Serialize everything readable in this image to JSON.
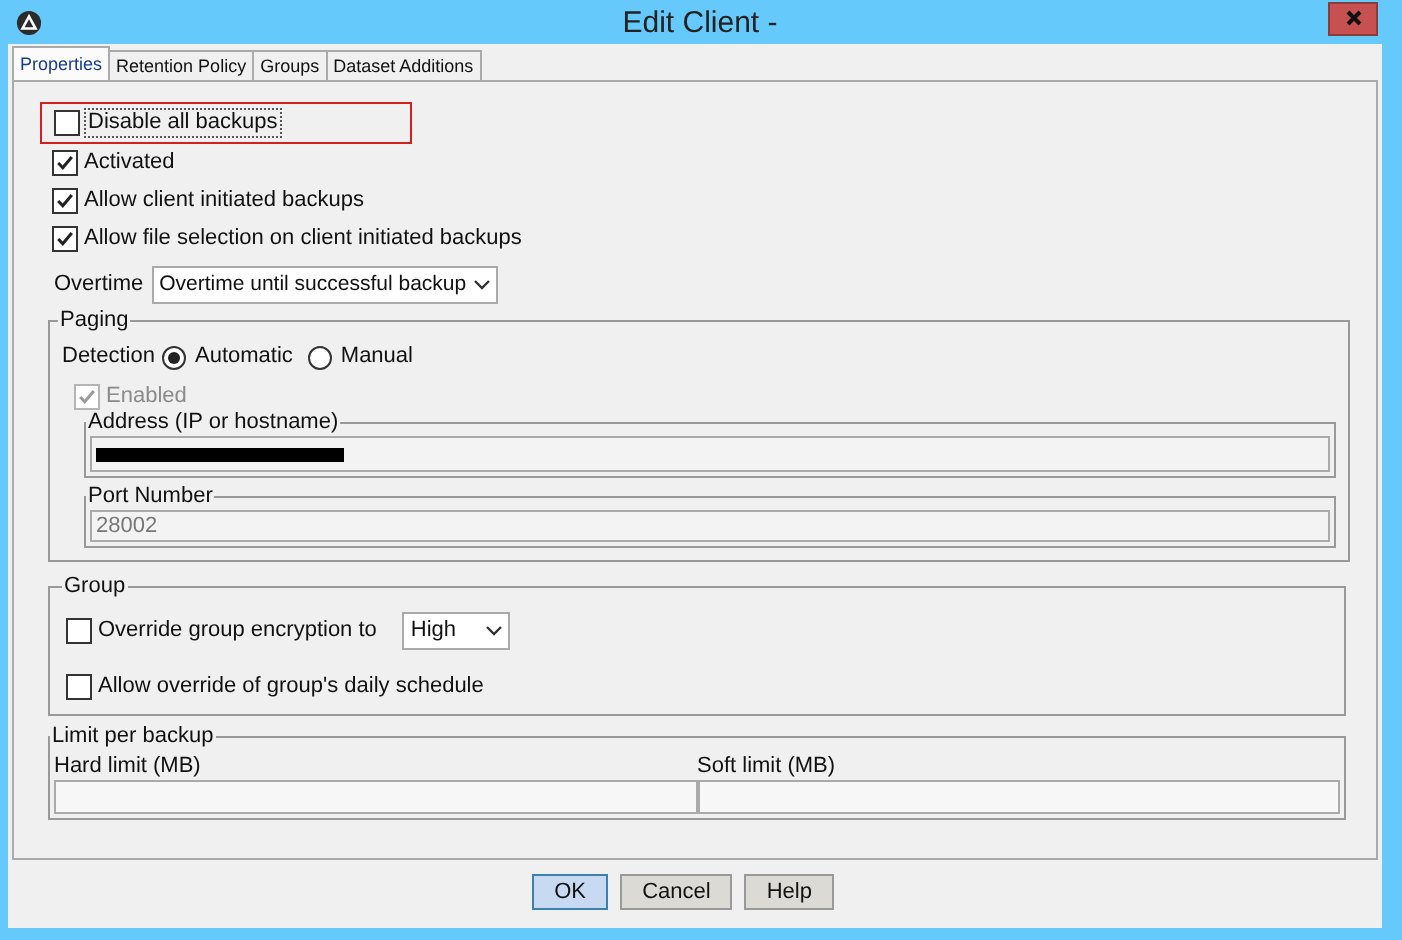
{
  "window": {
    "title": "Edit Client -"
  },
  "tabs": [
    {
      "label": "Properties",
      "selected": true
    },
    {
      "label": "Retention Policy",
      "selected": false
    },
    {
      "label": "Groups",
      "selected": false
    },
    {
      "label": "Dataset Additions",
      "selected": false
    }
  ],
  "disable_all_backups": {
    "label": "Disable all backups",
    "checked": false,
    "highlighted": true
  },
  "options": [
    {
      "label": "Activated",
      "checked": true
    },
    {
      "label": "Allow client initiated backups",
      "checked": true
    },
    {
      "label": "Allow file selection on client initiated backups",
      "checked": true
    }
  ],
  "overtime": {
    "label": "Overtime",
    "value": "Overtime until successful backup"
  },
  "paging": {
    "title": "Paging",
    "detection_label": "Detection",
    "detection_options": [
      {
        "label": "Automatic",
        "selected": true
      },
      {
        "label": "Manual",
        "selected": false
      }
    ],
    "enabled": {
      "label": "Enabled",
      "checked": true,
      "disabled": true
    },
    "address": {
      "title": "Address (IP or hostname)",
      "redacted": true
    },
    "port": {
      "title": "Port Number",
      "value": "28002",
      "disabled": true
    }
  },
  "group": {
    "title": "Group",
    "encryption": {
      "label": "Override group encryption to",
      "checked": false,
      "value": "High"
    },
    "schedule": {
      "label": "Allow override of group's daily schedule",
      "checked": false
    }
  },
  "limit": {
    "title": "Limit per backup",
    "hard_label": "Hard limit (MB)",
    "soft_label": "Soft limit (MB)"
  },
  "buttons": [
    {
      "label": "OK",
      "default": true
    },
    {
      "label": "Cancel",
      "default": false
    },
    {
      "label": "Help",
      "default": false
    }
  ]
}
